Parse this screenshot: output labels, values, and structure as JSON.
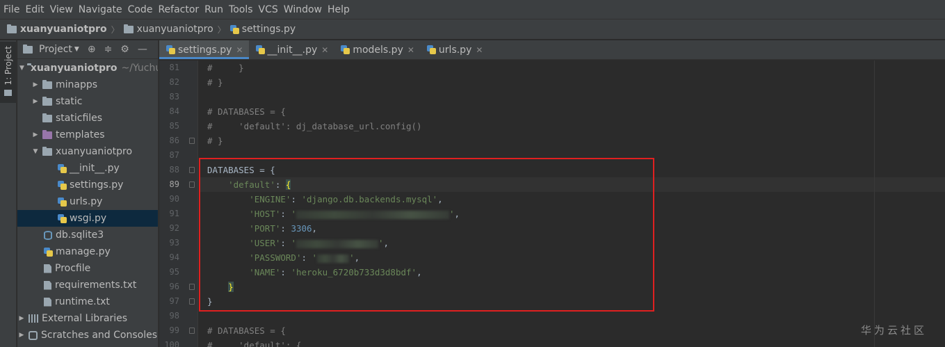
{
  "menu": [
    "File",
    "Edit",
    "View",
    "Navigate",
    "Code",
    "Refactor",
    "Run",
    "Tools",
    "VCS",
    "Window",
    "Help"
  ],
  "breadcrumb": [
    "xuanyuaniotpro",
    "xuanyuaniotpro",
    "settings.py"
  ],
  "toolstrip": {
    "project_tab": "1: Project"
  },
  "project_panel": {
    "title": "Project",
    "tree": [
      {
        "label": "xuanyuaniotpro",
        "extra": "~/Yuchu",
        "type": "folder-root",
        "expanded": true
      },
      {
        "label": "minapps",
        "type": "folder",
        "expanded": false
      },
      {
        "label": "static",
        "type": "folder",
        "expanded": false
      },
      {
        "label": "staticfiles",
        "type": "folder"
      },
      {
        "label": "templates",
        "type": "folder-purple",
        "expanded": false
      },
      {
        "label": "xuanyuaniotpro",
        "type": "folder",
        "expanded": true
      },
      {
        "label": "__init__.py",
        "type": "py"
      },
      {
        "label": "settings.py",
        "type": "py"
      },
      {
        "label": "urls.py",
        "type": "py"
      },
      {
        "label": "wsgi.py",
        "type": "py",
        "selected": true
      },
      {
        "label": "db.sqlite3",
        "type": "db"
      },
      {
        "label": "manage.py",
        "type": "py"
      },
      {
        "label": "Procfile",
        "type": "file"
      },
      {
        "label": "requirements.txt",
        "type": "file"
      },
      {
        "label": "runtime.txt",
        "type": "file"
      },
      {
        "label": "External Libraries",
        "type": "lib",
        "expanded": false
      },
      {
        "label": "Scratches and Consoles",
        "type": "scratch",
        "expanded": false
      }
    ]
  },
  "tabs": [
    {
      "label": "settings.py",
      "active": true
    },
    {
      "label": "__init__.py"
    },
    {
      "label": "models.py"
    },
    {
      "label": "urls.py"
    }
  ],
  "editor": {
    "current_line": "89",
    "lines": [
      {
        "n": "81",
        "t1": "#     }"
      },
      {
        "n": "82",
        "t1": "# }"
      },
      {
        "n": "83",
        "t1": ""
      },
      {
        "n": "84",
        "t1": "# DATABASES = {"
      },
      {
        "n": "85",
        "t1": "#     'default': dj_database_url.config()"
      },
      {
        "n": "86",
        "t1": "# }"
      },
      {
        "n": "87",
        "t1": ""
      },
      {
        "n": "88",
        "t1": "DATABASES = {"
      },
      {
        "n": "89",
        "t1": "    ",
        "t2": "'default'",
        "t3": ": ",
        "t4": "{"
      },
      {
        "n": "90",
        "t1": "        ",
        "t2": "'ENGINE'",
        "t3": ": ",
        "t4": "'django.db.backends.mysql'",
        "t5": ","
      },
      {
        "n": "91",
        "t1": "        ",
        "t2": "'HOST'",
        "t3": ": ",
        "t4": "'",
        "t5": "'",
        "t6": ","
      },
      {
        "n": "92",
        "t1": "        ",
        "t2": "'PORT'",
        "t3": ": ",
        "t4": "3306",
        "t5": ","
      },
      {
        "n": "93",
        "t1": "        ",
        "t2": "'USER'",
        "t3": ": ",
        "t4": "'",
        "t5": "'",
        "t6": ","
      },
      {
        "n": "94",
        "t1": "        ",
        "t2": "'PASSWORD'",
        "t3": ": ",
        "t4": "'",
        "t5": "'",
        "t6": ","
      },
      {
        "n": "95",
        "t1": "        ",
        "t2": "'NAME'",
        "t3": ": ",
        "t4": "'heroku_6720b733d3d8bdf'",
        "t5": ","
      },
      {
        "n": "96",
        "t1": "    ",
        "t2": "}"
      },
      {
        "n": "97",
        "t1": "}"
      },
      {
        "n": "98",
        "t1": ""
      },
      {
        "n": "99",
        "t1": "# DATABASES = {"
      },
      {
        "n": "100",
        "t1": "#     'default': {"
      }
    ]
  },
  "watermark": "华为云社区",
  "colors": {
    "background": "#2b2b2b",
    "panel": "#3c3f41",
    "string": "#6a8759",
    "number": "#6897bb",
    "comment": "#808080",
    "highlight_border": "#e02020",
    "tab_underline": "#4a88c7"
  }
}
